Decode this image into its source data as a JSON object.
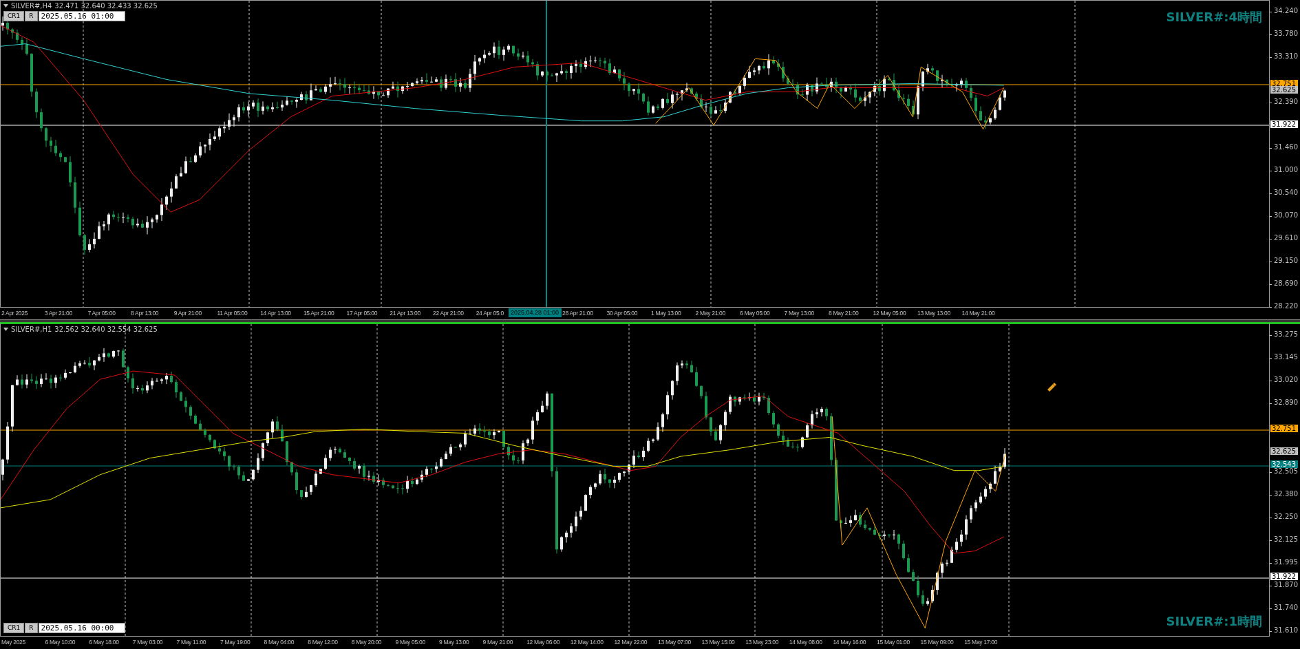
{
  "panels": [
    {
      "active": false,
      "header": {
        "symbol": "SILVER#,H4",
        "ohlc": "32.471 32.640 32.433 32.625"
      },
      "buttons": [
        "CR1",
        "R"
      ],
      "date": "2025.05.16 01:00",
      "label": "SILVER#:4時間",
      "price_ticks": [
        "34.240",
        "33.780",
        "33.310",
        "32.390",
        "31.460",
        "31.000",
        "30.540",
        "30.070",
        "29.610",
        "29.150",
        "28.690",
        "28.220"
      ],
      "price_tags": [
        {
          "text": "32.751",
          "color": "#ffa500"
        },
        {
          "text": "32.625",
          "color": "#c0c0c0"
        },
        {
          "text": "31.922",
          "color": "#ffffff"
        }
      ],
      "time_labels": [
        "2 Apr 2025",
        "3 Apr 21:00",
        "7 Apr 05:00",
        "8 Apr 13:00",
        "9 Apr 21:00",
        "11 Apr 05:00",
        "14 Apr 13:00",
        "15 Apr 21:00",
        "17 Apr 05:00",
        "21 Apr 13:00",
        "22 Apr 21:00",
        "24 Apr 05:0",
        "28 Apr 21:00",
        "30 Apr 05:00",
        "1 May 13:00",
        "2 May 21:00",
        "6 May 05:00",
        "7 May 13:00",
        "8 May 21:00",
        "12 May 05:00",
        "13 May 13:00",
        "14 May 21:00"
      ],
      "crosshair": {
        "time": "2025.04.28 01:00"
      }
    },
    {
      "active": true,
      "header": {
        "symbol": "SILVER#,H1",
        "ohlc": "32.562 32.640 32.554 32.625"
      },
      "buttons": [
        "CR1",
        "R"
      ],
      "date": "2025.05.16 00:00",
      "label": "SILVER#:1時間",
      "price_ticks": [
        "33.275",
        "33.145",
        "33.020",
        "32.890",
        "32.505",
        "32.380",
        "32.250",
        "32.125",
        "31.995",
        "31.870",
        "31.740",
        "31.610"
      ],
      "price_tags": [
        {
          "text": "32.751",
          "color": "#ffa500"
        },
        {
          "text": "32.625",
          "color": "#c0c0c0"
        },
        {
          "text": "32.543",
          "color": "#008080"
        },
        {
          "text": "31.922",
          "color": "#ffffff"
        }
      ],
      "time_labels": [
        "May 2025",
        "6 May 10:00",
        "6 May 18:00",
        "7 May 03:00",
        "7 May 11:00",
        "7 May 19:00",
        "8 May 04:00",
        "8 May 12:00",
        "8 May 20:00",
        "9 May 05:00",
        "9 May 13:00",
        "9 May 21:00",
        "12 May 06:00",
        "12 May 14:00",
        "12 May 22:00",
        "13 May 07:00",
        "13 May 15:00",
        "13 May 23:00",
        "14 May 08:00",
        "14 May 16:00",
        "15 May 01:00",
        "15 May 09:00",
        "15 May 17:00"
      ]
    }
  ]
}
